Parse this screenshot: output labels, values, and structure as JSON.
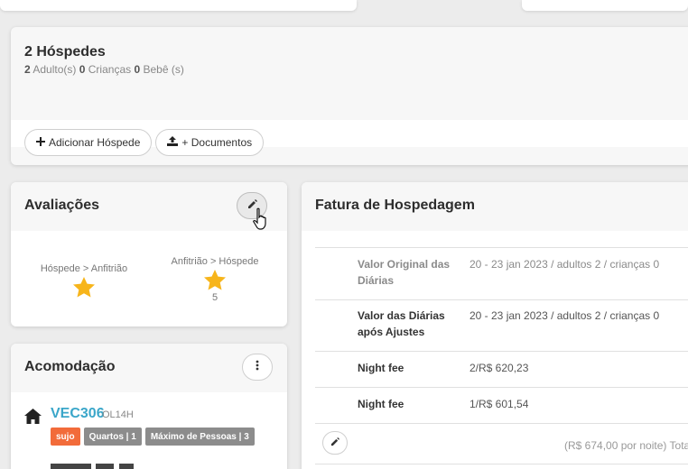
{
  "guests": {
    "title": "2 Hóspedes",
    "adults_count": "2",
    "adults_label": "Adulto(s)",
    "children_count": "0",
    "children_label": "Crianças",
    "babies_count": "0",
    "babies_label": "Bebê (s)",
    "add_guest_label": "Adicionar Hóspede",
    "add_guest_icon": "plus-icon",
    "documents_label": "+ Documentos",
    "documents_icon": "upload-icon"
  },
  "ratings": {
    "title": "Avaliações",
    "edit_icon": "pencil-icon",
    "guest_to_host_label": "Hóspede > Anfitrião",
    "host_to_guest_label": "Anfitrião > Hóspede",
    "host_to_guest_count": "5",
    "star_color": "#f7b51b"
  },
  "invoice": {
    "title": "Fatura de Hospedagem",
    "rows": [
      {
        "label": "Valor Original das Diárias",
        "value": "20 - 23 jan 2023  /  adultos 2 /  crianças 0"
      },
      {
        "label": "Valor das Diárias após Ajustes",
        "value": "20 - 23 jan 2023  /  adultos 2 /  crianças 0"
      },
      {
        "label": "Night fee",
        "value": "2/R$ 620,23"
      },
      {
        "label": "Night fee",
        "value": "1/R$ 601,54"
      }
    ],
    "footer_total": "(R$ 674,00 por noite) Total",
    "edit_icon": "pencil-icon"
  },
  "accommodation": {
    "title": "Acomodação",
    "menu_icon": "kebab-menu-icon",
    "room_code": "VEC306",
    "room_sub": "OL14H",
    "badges": {
      "status": "sujo",
      "rooms": "Quartos | 1",
      "max_people": "Máximo de Pessoas | 3"
    },
    "colors": {
      "room_code": "#3aa6c9",
      "status_badge": "#f26b3a",
      "gray_badge": "#8c8c8c"
    }
  }
}
